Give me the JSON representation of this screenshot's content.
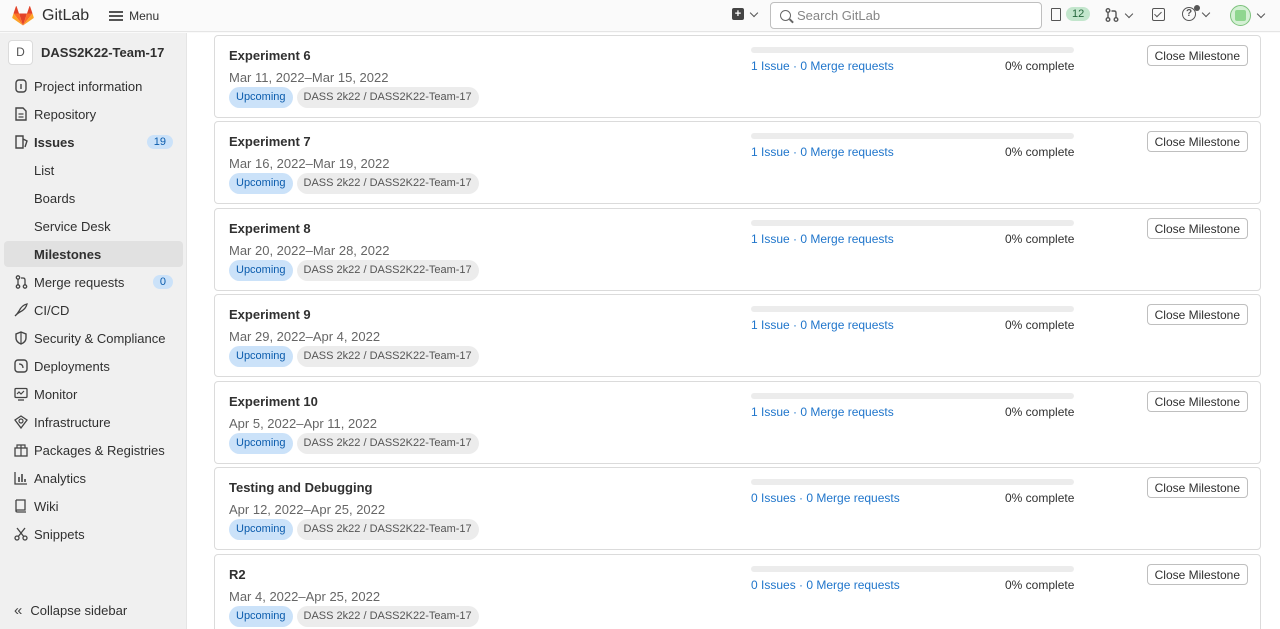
{
  "header": {
    "brand": "GitLab",
    "menu_label": "Menu",
    "search_placeholder": "Search GitLab",
    "issues_count": "12"
  },
  "sidebar": {
    "project_initial": "D",
    "project_name": "DASS2K22-Team-17",
    "items": [
      {
        "label": "Project information",
        "icon": "info-doc-icon"
      },
      {
        "label": "Repository",
        "icon": "file-icon"
      },
      {
        "label": "Issues",
        "icon": "issues-icon",
        "count": "19"
      },
      {
        "label": "List"
      },
      {
        "label": "Boards"
      },
      {
        "label": "Service Desk"
      },
      {
        "label": "Milestones"
      },
      {
        "label": "Merge requests",
        "icon": "merge-request-icon",
        "count": "0"
      },
      {
        "label": "CI/CD",
        "icon": "rocket-icon"
      },
      {
        "label": "Security & Compliance",
        "icon": "shield-icon"
      },
      {
        "label": "Deployments",
        "icon": "deployments-icon"
      },
      {
        "label": "Monitor",
        "icon": "monitor-icon"
      },
      {
        "label": "Infrastructure",
        "icon": "cloud-icon"
      },
      {
        "label": "Packages & Registries",
        "icon": "package-icon"
      },
      {
        "label": "Analytics",
        "icon": "chart-icon"
      },
      {
        "label": "Wiki",
        "icon": "book-icon"
      },
      {
        "label": "Snippets",
        "icon": "scissors-icon"
      }
    ],
    "collapse_label": "Collapse sidebar"
  },
  "milestones": [
    {
      "title": "Experiment 6",
      "dates": "Mar 11, 2022–Mar 15, 2022",
      "status": "Upcoming",
      "path": "DASS 2k22 / DASS2K22-Team-17",
      "links": "1 Issue · 0 Merge requests",
      "percent": "0% complete",
      "progress": 0,
      "button": "Close Milestone"
    },
    {
      "title": "Experiment 7",
      "dates": "Mar 16, 2022–Mar 19, 2022",
      "status": "Upcoming",
      "path": "DASS 2k22 / DASS2K22-Team-17",
      "links": "1 Issue · 0 Merge requests",
      "percent": "0% complete",
      "progress": 0,
      "button": "Close Milestone"
    },
    {
      "title": "Experiment 8",
      "dates": "Mar 20, 2022–Mar 28, 2022",
      "status": "Upcoming",
      "path": "DASS 2k22 / DASS2K22-Team-17",
      "links": "1 Issue · 0 Merge requests",
      "percent": "0% complete",
      "progress": 0,
      "button": "Close Milestone"
    },
    {
      "title": "Experiment 9",
      "dates": "Mar 29, 2022–Apr 4, 2022",
      "status": "Upcoming",
      "path": "DASS 2k22 / DASS2K22-Team-17",
      "links": "1 Issue · 0 Merge requests",
      "percent": "0% complete",
      "progress": 0,
      "button": "Close Milestone"
    },
    {
      "title": "Experiment 10",
      "dates": "Apr 5, 2022–Apr 11, 2022",
      "status": "Upcoming",
      "path": "DASS 2k22 / DASS2K22-Team-17",
      "links": "1 Issue · 0 Merge requests",
      "percent": "0% complete",
      "progress": 0,
      "button": "Close Milestone"
    },
    {
      "title": "Testing and Debugging",
      "dates": "Apr 12, 2022–Apr 25, 2022",
      "status": "Upcoming",
      "path": "DASS 2k22 / DASS2K22-Team-17",
      "links": "0 Issues · 0 Merge requests",
      "percent": "0% complete",
      "progress": 0,
      "button": "Close Milestone"
    },
    {
      "title": "R2",
      "dates": "Mar 4, 2022–Apr 25, 2022",
      "status": "Upcoming",
      "path": "DASS 2k22 / DASS2K22-Team-17",
      "links": "0 Issues · 0 Merge requests",
      "percent": "0% complete",
      "progress": 0,
      "button": "Close Milestone"
    }
  ],
  "colors": {
    "accent": "#1f75cb",
    "badge_bg": "#cbe2f9",
    "brand_orange": "#fc6d26"
  }
}
